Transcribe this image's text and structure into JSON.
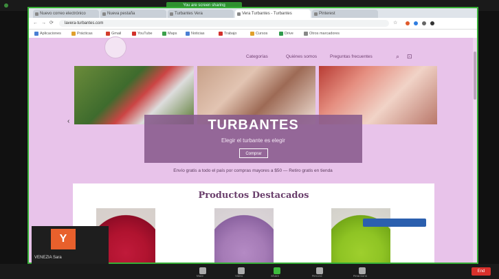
{
  "zoom": {
    "share_banner": "You are screen sharing",
    "participant_name": "VENEZIA Sara",
    "avatar_letter": "Y",
    "end_label": "End",
    "bottom_labels": [
      "Mute",
      "Video",
      "Share",
      "Record",
      "Reactions"
    ]
  },
  "browser": {
    "tabs": [
      {
        "label": "Nuevo correo electrónico"
      },
      {
        "label": "Nueva pestaña"
      },
      {
        "label": "Turbantes Vera"
      },
      {
        "label": "Vera Turbantes - Turbantes"
      },
      {
        "label": "Pinterest"
      }
    ],
    "active_tab": 3,
    "url": "lavera-turbantes.com",
    "bookmarks": [
      "Aplicaciones",
      "Prácticas",
      "Gmail",
      "YouTube",
      "Maps",
      "Noticias",
      "Trabajo",
      "Cursos",
      "Drive",
      "Otros marcadores"
    ]
  },
  "site": {
    "menu": [
      "Categorías",
      "Quiénes somos",
      "Preguntas frecuentes"
    ],
    "hero": {
      "title": "TURBANTES",
      "subtitle": "Elegir el turbante es elegir",
      "button": "Comprar"
    },
    "promo_text": "Envío gratis a todo el país por compras mayores a $50 — Retiro gratis en tienda",
    "products_title": "Productos Destacados"
  },
  "colors": {
    "site_bg": "#e8c3ea",
    "hero_overlay": "#885a8c",
    "share_border": "#36b036",
    "end_button": "#d9302c",
    "avatar_bg": "#e8602c"
  },
  "icons": [
    "back-icon",
    "forward-icon",
    "reload-icon",
    "star-icon",
    "search-icon",
    "cart-icon",
    "chevron-left-icon"
  ]
}
